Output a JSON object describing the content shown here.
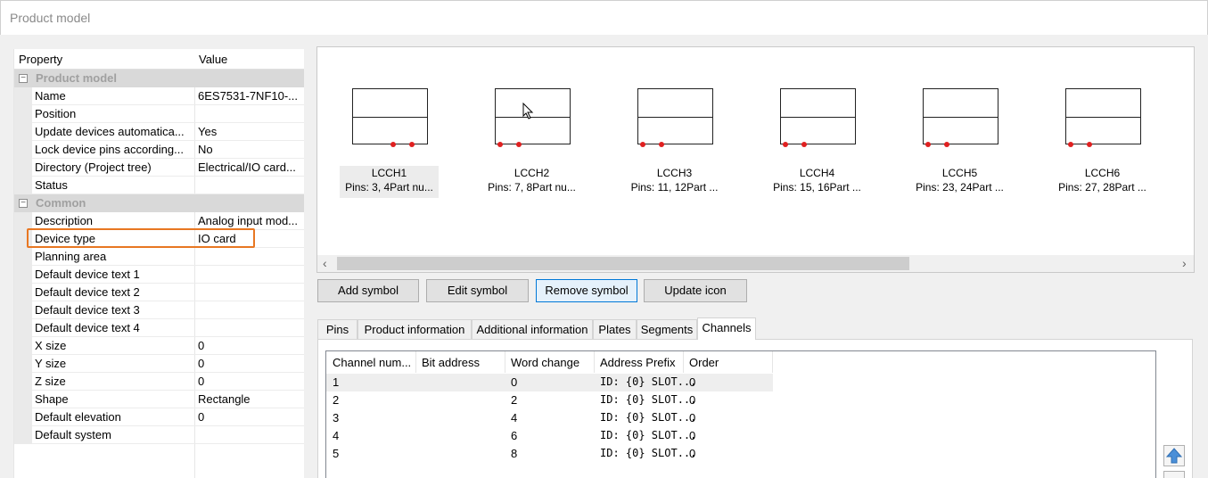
{
  "window": {
    "title": "Product model"
  },
  "grid": {
    "headers": {
      "property": "Property",
      "value": "Value"
    },
    "categories": {
      "product_model": "Product model",
      "common": "Common"
    },
    "rows": [
      {
        "key": "Name",
        "value": "6ES7531-7NF10-..."
      },
      {
        "key": "Position",
        "value": ""
      },
      {
        "key": "Update devices automatica...",
        "value": "Yes"
      },
      {
        "key": "Lock device pins according...",
        "value": "No"
      },
      {
        "key": "Directory (Project tree)",
        "value": "Electrical/IO card..."
      },
      {
        "key": "Status",
        "value": ""
      },
      {
        "key": "Description",
        "value": "Analog input mod..."
      },
      {
        "key": "Device type",
        "value": "IO card"
      },
      {
        "key": "Planning area",
        "value": ""
      },
      {
        "key": "Default device text 1",
        "value": ""
      },
      {
        "key": "Default device text 2",
        "value": ""
      },
      {
        "key": "Default device text 3",
        "value": ""
      },
      {
        "key": "Default device text 4",
        "value": ""
      },
      {
        "key": "X size",
        "value": "0"
      },
      {
        "key": "Y size",
        "value": "0"
      },
      {
        "key": "Z size",
        "value": "0"
      },
      {
        "key": "Shape",
        "value": "Rectangle"
      },
      {
        "key": "Default elevation",
        "value": "0"
      },
      {
        "key": "Default system",
        "value": ""
      }
    ]
  },
  "symbols": [
    {
      "name": "LCCH1",
      "info": "Pins: 3, 4Part nu..."
    },
    {
      "name": "LCCH2",
      "info": "Pins: 7, 8Part nu..."
    },
    {
      "name": "LCCH3",
      "info": "Pins: 11, 12Part ..."
    },
    {
      "name": "LCCH4",
      "info": "Pins: 15, 16Part ..."
    },
    {
      "name": "LCCH5",
      "info": "Pins: 23, 24Part ..."
    },
    {
      "name": "LCCH6",
      "info": "Pins: 27, 28Part ..."
    }
  ],
  "buttons": {
    "add": "Add symbol",
    "edit": "Edit symbol",
    "remove": "Remove symbol",
    "update": "Update icon"
  },
  "tabs": [
    "Pins",
    "Product information",
    "Additional information",
    "Plates",
    "Segments",
    "Channels"
  ],
  "channels": {
    "headers": [
      "Channel num...",
      "Bit address",
      "Word change",
      "Address Prefix",
      "Order"
    ],
    "rows": [
      [
        "1",
        "",
        "0",
        "ID: {0} SLOT...",
        "0"
      ],
      [
        "2",
        "",
        "2",
        "ID: {0} SLOT...",
        "0"
      ],
      [
        "3",
        "",
        "4",
        "ID: {0} SLOT...",
        "0"
      ],
      [
        "4",
        "",
        "6",
        "ID: {0} SLOT...",
        "0"
      ],
      [
        "5",
        "",
        "8",
        "ID: {0} SLOT...",
        "0"
      ]
    ]
  },
  "colors": {
    "highlight": "#e87722",
    "pin_dot": "#e02020",
    "focus": "#0078d7"
  }
}
